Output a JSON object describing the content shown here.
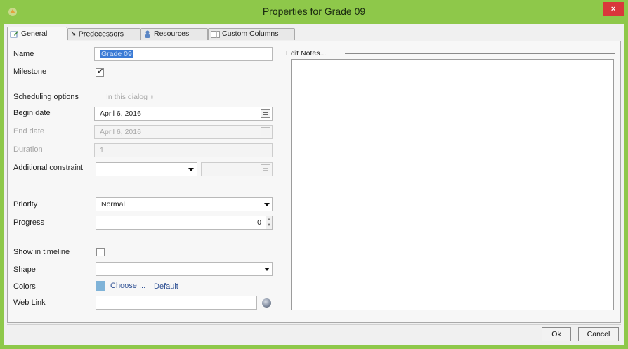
{
  "window": {
    "title": "Properties for Grade 09",
    "close_glyph": "×"
  },
  "tabs": [
    {
      "label": "General",
      "icon": "edit-icon"
    },
    {
      "label": "Predecessors",
      "icon": "arrow-icon"
    },
    {
      "label": "Resources",
      "icon": "people-icon"
    },
    {
      "label": "Custom Columns",
      "icon": "columns-icon"
    }
  ],
  "form": {
    "name_label": "Name",
    "name_value": "Grade 09",
    "milestone_label": "Milestone",
    "milestone_checked": true,
    "scheduling_label": "Scheduling options",
    "scheduling_value": "In this dialog",
    "begin_label": "Begin date",
    "begin_value": "April 6, 2016",
    "end_label": "End date",
    "end_value": "April 6, 2016",
    "duration_label": "Duration",
    "duration_value": "1",
    "constraint_label": "Additional constraint",
    "constraint_value": "",
    "constraint_date": "",
    "priority_label": "Priority",
    "priority_value": "Normal",
    "progress_label": "Progress",
    "progress_value": "0",
    "timeline_label": "Show in timeline",
    "timeline_checked": false,
    "shape_label": "Shape",
    "shape_value": "",
    "colors_label": "Colors",
    "color_swatch": "#7fb3d8",
    "choose_label": "Choose ...",
    "default_label": "Default",
    "weblink_label": "Web Link",
    "weblink_value": ""
  },
  "notes": {
    "legend": "Edit Notes...",
    "text": ""
  },
  "buttons": {
    "ok": "Ok",
    "cancel": "Cancel"
  },
  "colors": {
    "titlebar": "#8ec84a",
    "close": "#d9373b",
    "selection": "#3b7bd5"
  }
}
